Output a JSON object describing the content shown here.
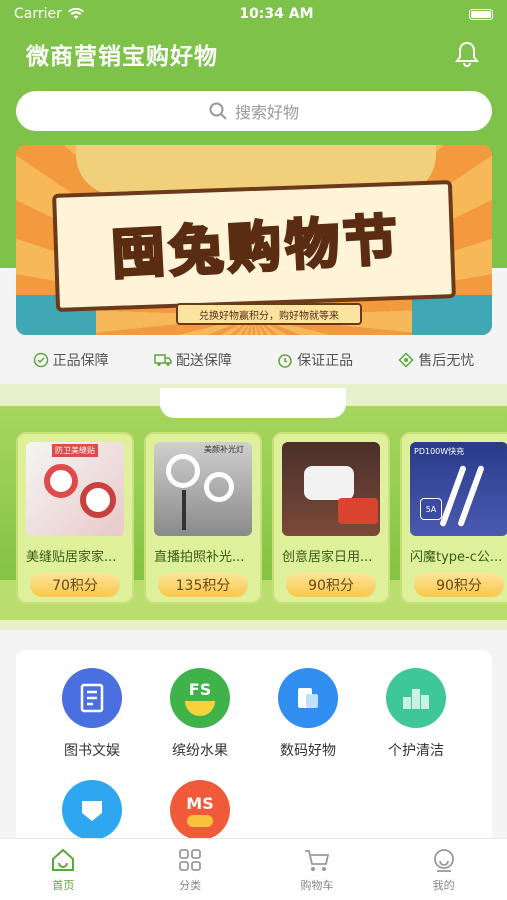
{
  "status_bar": {
    "carrier": "Carrier",
    "time": "10:34 AM"
  },
  "header": {
    "title": "微商营销宝购好物",
    "bell_icon": "bell-icon"
  },
  "search": {
    "placeholder": "搜索好物",
    "icon": "search-icon"
  },
  "banner": {
    "title": "囤兔购物节",
    "subtitle": "兑换好物赢积分，购好物就等来"
  },
  "guarantees": [
    {
      "label": "正品保障",
      "icon": "shield-icon"
    },
    {
      "label": "配送保障",
      "icon": "truck-icon"
    },
    {
      "label": "保证正品",
      "icon": "clock-icon"
    },
    {
      "label": "售后无忧",
      "icon": "service-icon"
    }
  ],
  "products": [
    {
      "name": "美缝贴居家家...",
      "price": "70积分",
      "tag": "防卫美缝贴"
    },
    {
      "name": "直播拍照补光...",
      "price": "135积分",
      "tag": "美颜补光灯"
    },
    {
      "name": "创意居家日用...",
      "price": "90积分",
      "tag": ""
    },
    {
      "name": "闪魔type-c公...",
      "price": "90积分",
      "tag": "PD100W快充"
    }
  ],
  "categories": [
    {
      "label": "图书文娱",
      "icon": "book-icon",
      "color": "#4a6fe0",
      "text": ""
    },
    {
      "label": "缤纷水果",
      "icon": "fruit-icon",
      "color": "#3fb24a",
      "text": "FS"
    },
    {
      "label": "数码好物",
      "icon": "device-icon",
      "color": "#2f8ef0",
      "text": ""
    },
    {
      "label": "个护清洁",
      "icon": "care-icon",
      "color": "#3fc79a",
      "text": ""
    },
    {
      "label": "",
      "icon": "chat-icon",
      "color": "#2fa6f0",
      "text": ""
    },
    {
      "label": "",
      "icon": "ms-icon",
      "color": "#f05a3a",
      "text": "MS"
    }
  ],
  "tabbar": [
    {
      "label": "首页",
      "icon": "home-icon",
      "active": true
    },
    {
      "label": "分类",
      "icon": "grid-icon",
      "active": false
    },
    {
      "label": "购物车",
      "icon": "cart-icon",
      "active": false
    },
    {
      "label": "我的",
      "icon": "profile-icon",
      "active": false
    }
  ]
}
